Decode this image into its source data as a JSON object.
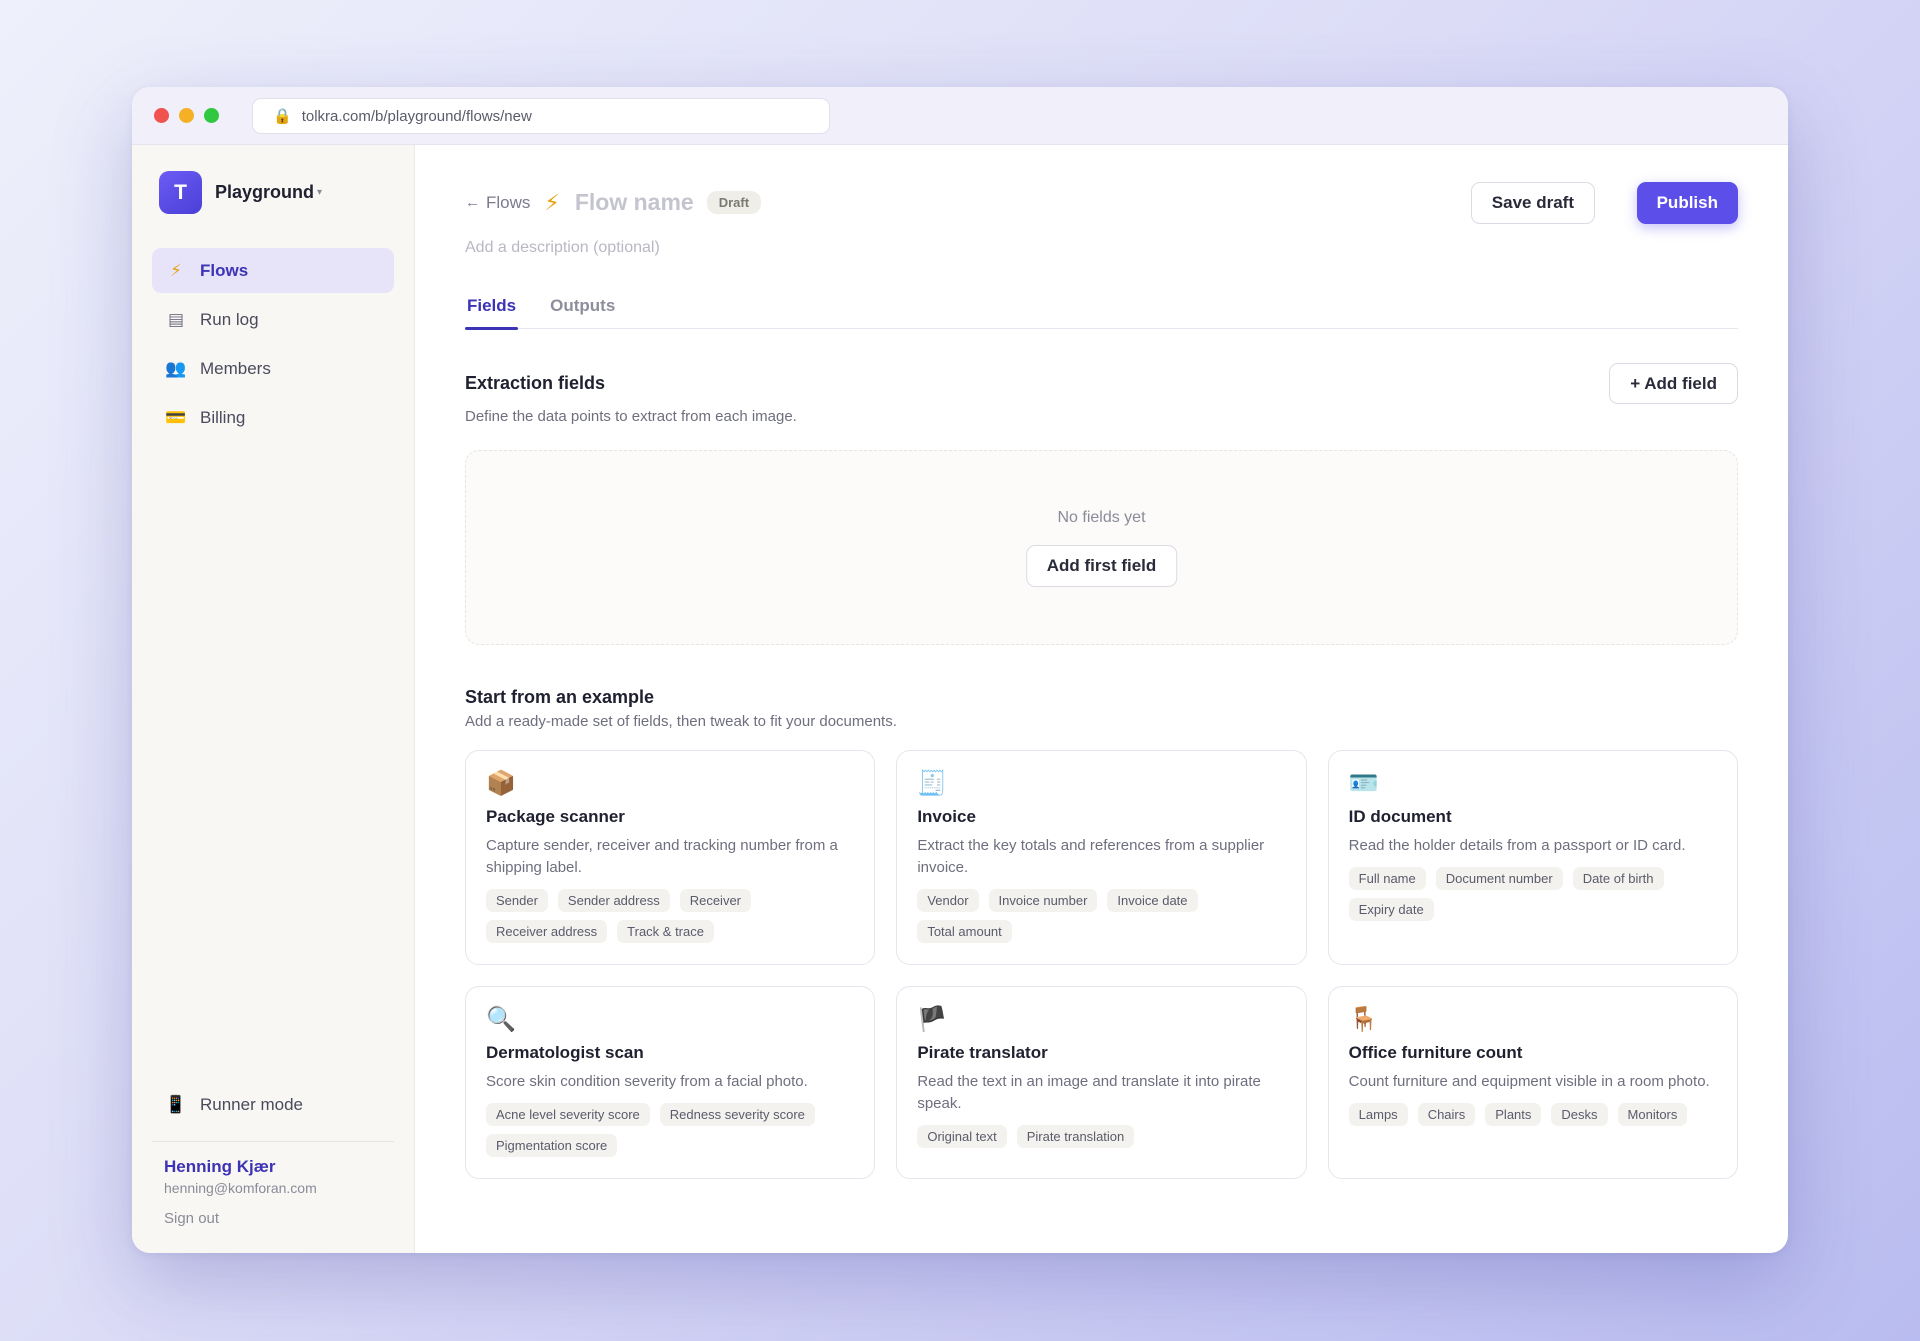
{
  "browser": {
    "url": "tolkra.com/b/playground/flows/new"
  },
  "sidebar": {
    "workspace": {
      "logo_letter": "T",
      "name": "Playground",
      "caret": "▾"
    },
    "items": [
      {
        "icon": "bolt-icon",
        "glyph": "⚡",
        "label": "Flows",
        "active": true
      },
      {
        "icon": "log-icon",
        "glyph": "▤",
        "label": "Run log",
        "active": false
      },
      {
        "icon": "members-icon",
        "glyph": "👥",
        "label": "Members",
        "active": false
      },
      {
        "icon": "card-icon",
        "glyph": "💳",
        "label": "Billing",
        "active": false
      }
    ],
    "runner": {
      "glyph": "📱",
      "label": "Runner mode"
    },
    "user": {
      "name": "Henning Kjær",
      "email": "henning@komforan.com",
      "signout": "Sign out"
    }
  },
  "header": {
    "back_label": "Flows",
    "back_arrow": "←",
    "bolt": "⚡",
    "flow_name": "Flow name",
    "status": "Draft",
    "save_label": "Save draft",
    "publish_label": "Publish",
    "description_placeholder": "Add a description (optional)"
  },
  "tabs": [
    {
      "label": "Fields",
      "active": true
    },
    {
      "label": "Outputs",
      "active": false
    }
  ],
  "fields_section": {
    "title": "Extraction fields",
    "subtitle": "Define the data points to extract from each image.",
    "add_label": "+ Add field",
    "empty_text": "No fields yet",
    "add_first_label": "Add first field"
  },
  "examples": {
    "title": "Start from an example",
    "subtitle": "Add a ready-made set of fields, then tweak to fit your documents.",
    "cards": [
      {
        "icon": "package-icon",
        "glyph": "📦",
        "title": "Package scanner",
        "desc": "Capture sender, receiver and tracking number from a shipping label.",
        "chips": [
          "Sender",
          "Sender address",
          "Receiver",
          "Receiver address",
          "Track & trace"
        ]
      },
      {
        "icon": "receipt-icon",
        "glyph": "🧾",
        "title": "Invoice",
        "desc": "Extract the key totals and references from a supplier invoice.",
        "chips": [
          "Vendor",
          "Invoice number",
          "Invoice date",
          "Total amount"
        ]
      },
      {
        "icon": "id-card-icon",
        "glyph": "🪪",
        "title": "ID document",
        "desc": "Read the holder details from a passport or ID card.",
        "chips": [
          "Full name",
          "Document number",
          "Date of birth",
          "Expiry date"
        ]
      },
      {
        "icon": "magnifier-icon",
        "glyph": "🔍",
        "title": "Dermatologist scan",
        "desc": "Score skin condition severity from a facial photo.",
        "chips": [
          "Acne level severity score",
          "Redness severity score",
          "Pigmentation score"
        ]
      },
      {
        "icon": "pirate-flag-icon",
        "glyph": "🏴",
        "title": "Pirate translator",
        "desc": "Read the text in an image and translate it into pirate speak.",
        "chips": [
          "Original text",
          "Pirate translation"
        ]
      },
      {
        "icon": "chair-icon",
        "glyph": "🪑",
        "title": "Office furniture count",
        "desc": "Count furniture and equipment visible in a room photo.",
        "chips": [
          "Lamps",
          "Chairs",
          "Plants",
          "Desks",
          "Monitors"
        ]
      }
    ]
  }
}
